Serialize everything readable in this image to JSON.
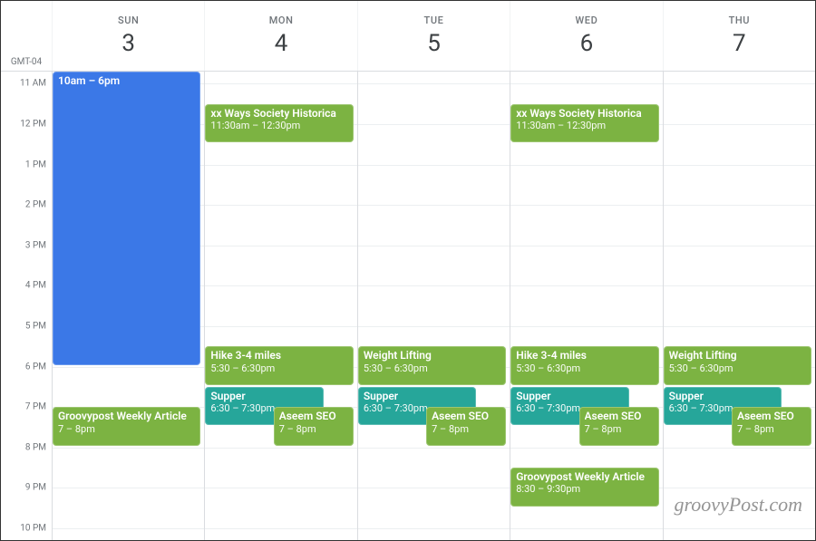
{
  "timezone": "GMT-04",
  "grid": {
    "startHour": 10.7,
    "endHour": 22.3,
    "hourHeight": 44.6
  },
  "timeLabels": [
    {
      "hour": 11,
      "text": "11 AM"
    },
    {
      "hour": 12,
      "text": "12 PM"
    },
    {
      "hour": 13,
      "text": "1 PM"
    },
    {
      "hour": 14,
      "text": "2 PM"
    },
    {
      "hour": 15,
      "text": "3 PM"
    },
    {
      "hour": 16,
      "text": "4 PM"
    },
    {
      "hour": 17,
      "text": "5 PM"
    },
    {
      "hour": 18,
      "text": "6 PM"
    },
    {
      "hour": 19,
      "text": "7 PM"
    },
    {
      "hour": 20,
      "text": "8 PM"
    },
    {
      "hour": 21,
      "text": "9 PM"
    },
    {
      "hour": 22,
      "text": "10 PM"
    }
  ],
  "colors": {
    "blue": "#3b78e7",
    "green": "#7cb342",
    "teal": "#26a69a"
  },
  "days": [
    {
      "name": "SUN",
      "num": "3",
      "events": [
        {
          "title": "",
          "timeText": "10am – 6pm",
          "start": 10,
          "end": 18,
          "color": "blue",
          "half": false,
          "titleOnly": true
        },
        {
          "title": "Groovypost Weekly Article",
          "timeText": "7 – 8pm",
          "start": 19,
          "end": 20,
          "color": "green",
          "half": false
        }
      ]
    },
    {
      "name": "MON",
      "num": "4",
      "events": [
        {
          "title": "xx Ways Society Historica",
          "timeText": "11:30am – 12:30pm",
          "start": 11.5,
          "end": 12.5,
          "color": "green",
          "half": false
        },
        {
          "title": "Hike 3-4 miles",
          "timeText": "5:30 – 6:30pm",
          "start": 17.5,
          "end": 18.5,
          "color": "green",
          "half": false
        },
        {
          "title": "Supper",
          "timeText": "6:30 – 7:30pm",
          "start": 18.5,
          "end": 19.5,
          "color": "teal",
          "half": false,
          "narrow": true
        },
        {
          "title": "Aseem SEO",
          "timeText": "7 – 8pm",
          "start": 19,
          "end": 20,
          "color": "green",
          "half": true
        }
      ]
    },
    {
      "name": "TUE",
      "num": "5",
      "events": [
        {
          "title": "Weight Lifting",
          "timeText": "5:30 – 6:30pm",
          "start": 17.5,
          "end": 18.5,
          "color": "green",
          "half": false
        },
        {
          "title": "Supper",
          "timeText": "6:30 – 7:30pm",
          "start": 18.5,
          "end": 19.5,
          "color": "teal",
          "half": false,
          "narrow": true
        },
        {
          "title": "Aseem SEO",
          "timeText": "7 – 8pm",
          "start": 19,
          "end": 20,
          "color": "green",
          "half": true
        }
      ]
    },
    {
      "name": "WED",
      "num": "6",
      "events": [
        {
          "title": "xx Ways Society Historica",
          "timeText": "11:30am – 12:30pm",
          "start": 11.5,
          "end": 12.5,
          "color": "green",
          "half": false
        },
        {
          "title": "Hike 3-4 miles",
          "timeText": "5:30 – 6:30pm",
          "start": 17.5,
          "end": 18.5,
          "color": "green",
          "half": false
        },
        {
          "title": "Supper",
          "timeText": "6:30 – 7:30pm",
          "start": 18.5,
          "end": 19.5,
          "color": "teal",
          "half": false,
          "narrow": true
        },
        {
          "title": "Aseem SEO",
          "timeText": "7 – 8pm",
          "start": 19,
          "end": 20,
          "color": "green",
          "half": true
        },
        {
          "title": "Groovypost Weekly Article",
          "timeText": "8:30 – 9:30pm",
          "start": 20.5,
          "end": 21.5,
          "color": "green",
          "half": false
        }
      ]
    },
    {
      "name": "THU",
      "num": "7",
      "events": [
        {
          "title": "Weight Lifting",
          "timeText": "5:30 – 6:30pm",
          "start": 17.5,
          "end": 18.5,
          "color": "green",
          "half": false
        },
        {
          "title": "Supper",
          "timeText": "6:30 – 7:30pm",
          "start": 18.5,
          "end": 19.5,
          "color": "teal",
          "half": false,
          "narrow": true
        },
        {
          "title": "Aseem SEO",
          "timeText": "7 – 8pm",
          "start": 19,
          "end": 20,
          "color": "green",
          "half": true
        }
      ]
    }
  ],
  "watermark": "groovyPost.com"
}
